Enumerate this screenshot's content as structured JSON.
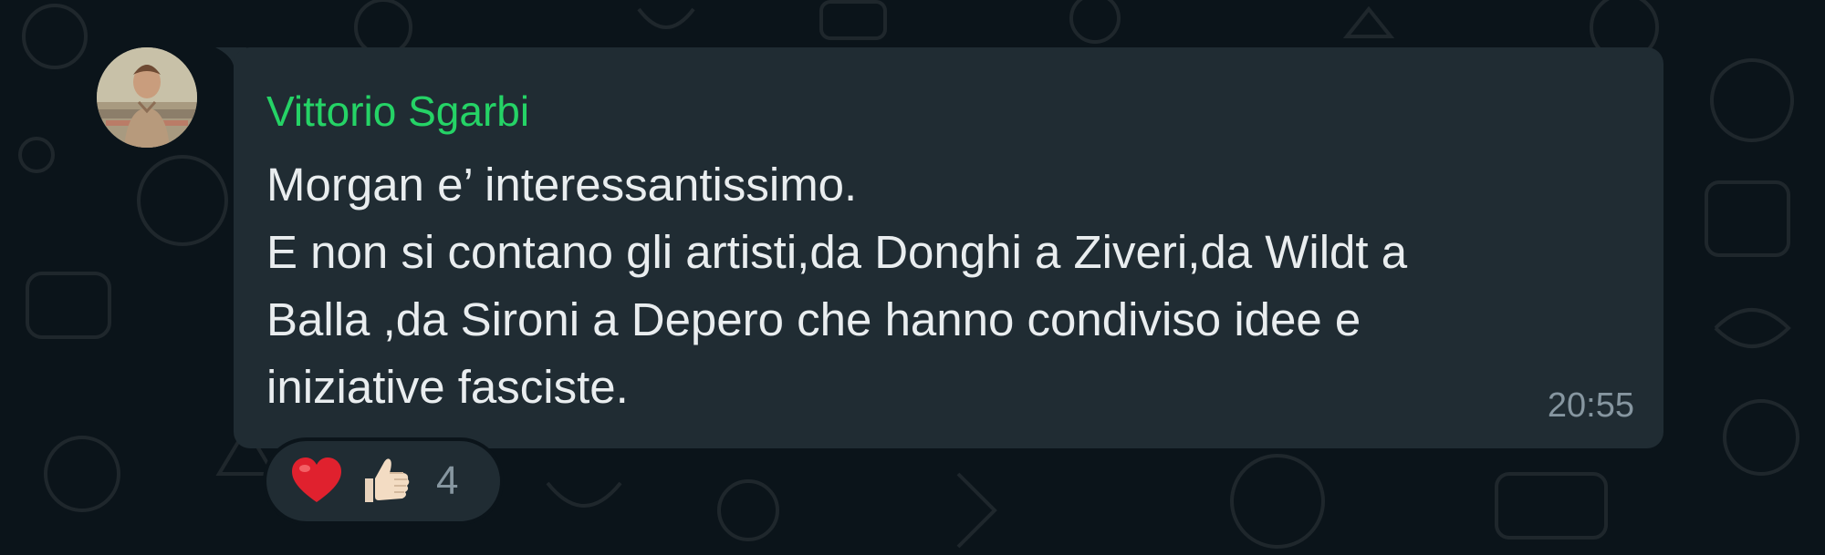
{
  "message": {
    "sender": "Vittorio Sgarbi",
    "lines": [
      "Morgan e’ interessantissimo.",
      "E non si contano gli artisti,da Donghi a Ziveri,da Wildt a",
      "Balla ,da Sironi a Depero che hanno condiviso idee e",
      "iniziative fasciste."
    ],
    "time": "20:55"
  },
  "reactions": {
    "icons": [
      "red-heart-icon",
      "thumbs-up-icon"
    ],
    "count": "4"
  },
  "colors": {
    "background": "#0b141a",
    "bubble": "#202c33",
    "sender": "#25d366",
    "text": "#e9edef",
    "meta": "#8696a0"
  }
}
